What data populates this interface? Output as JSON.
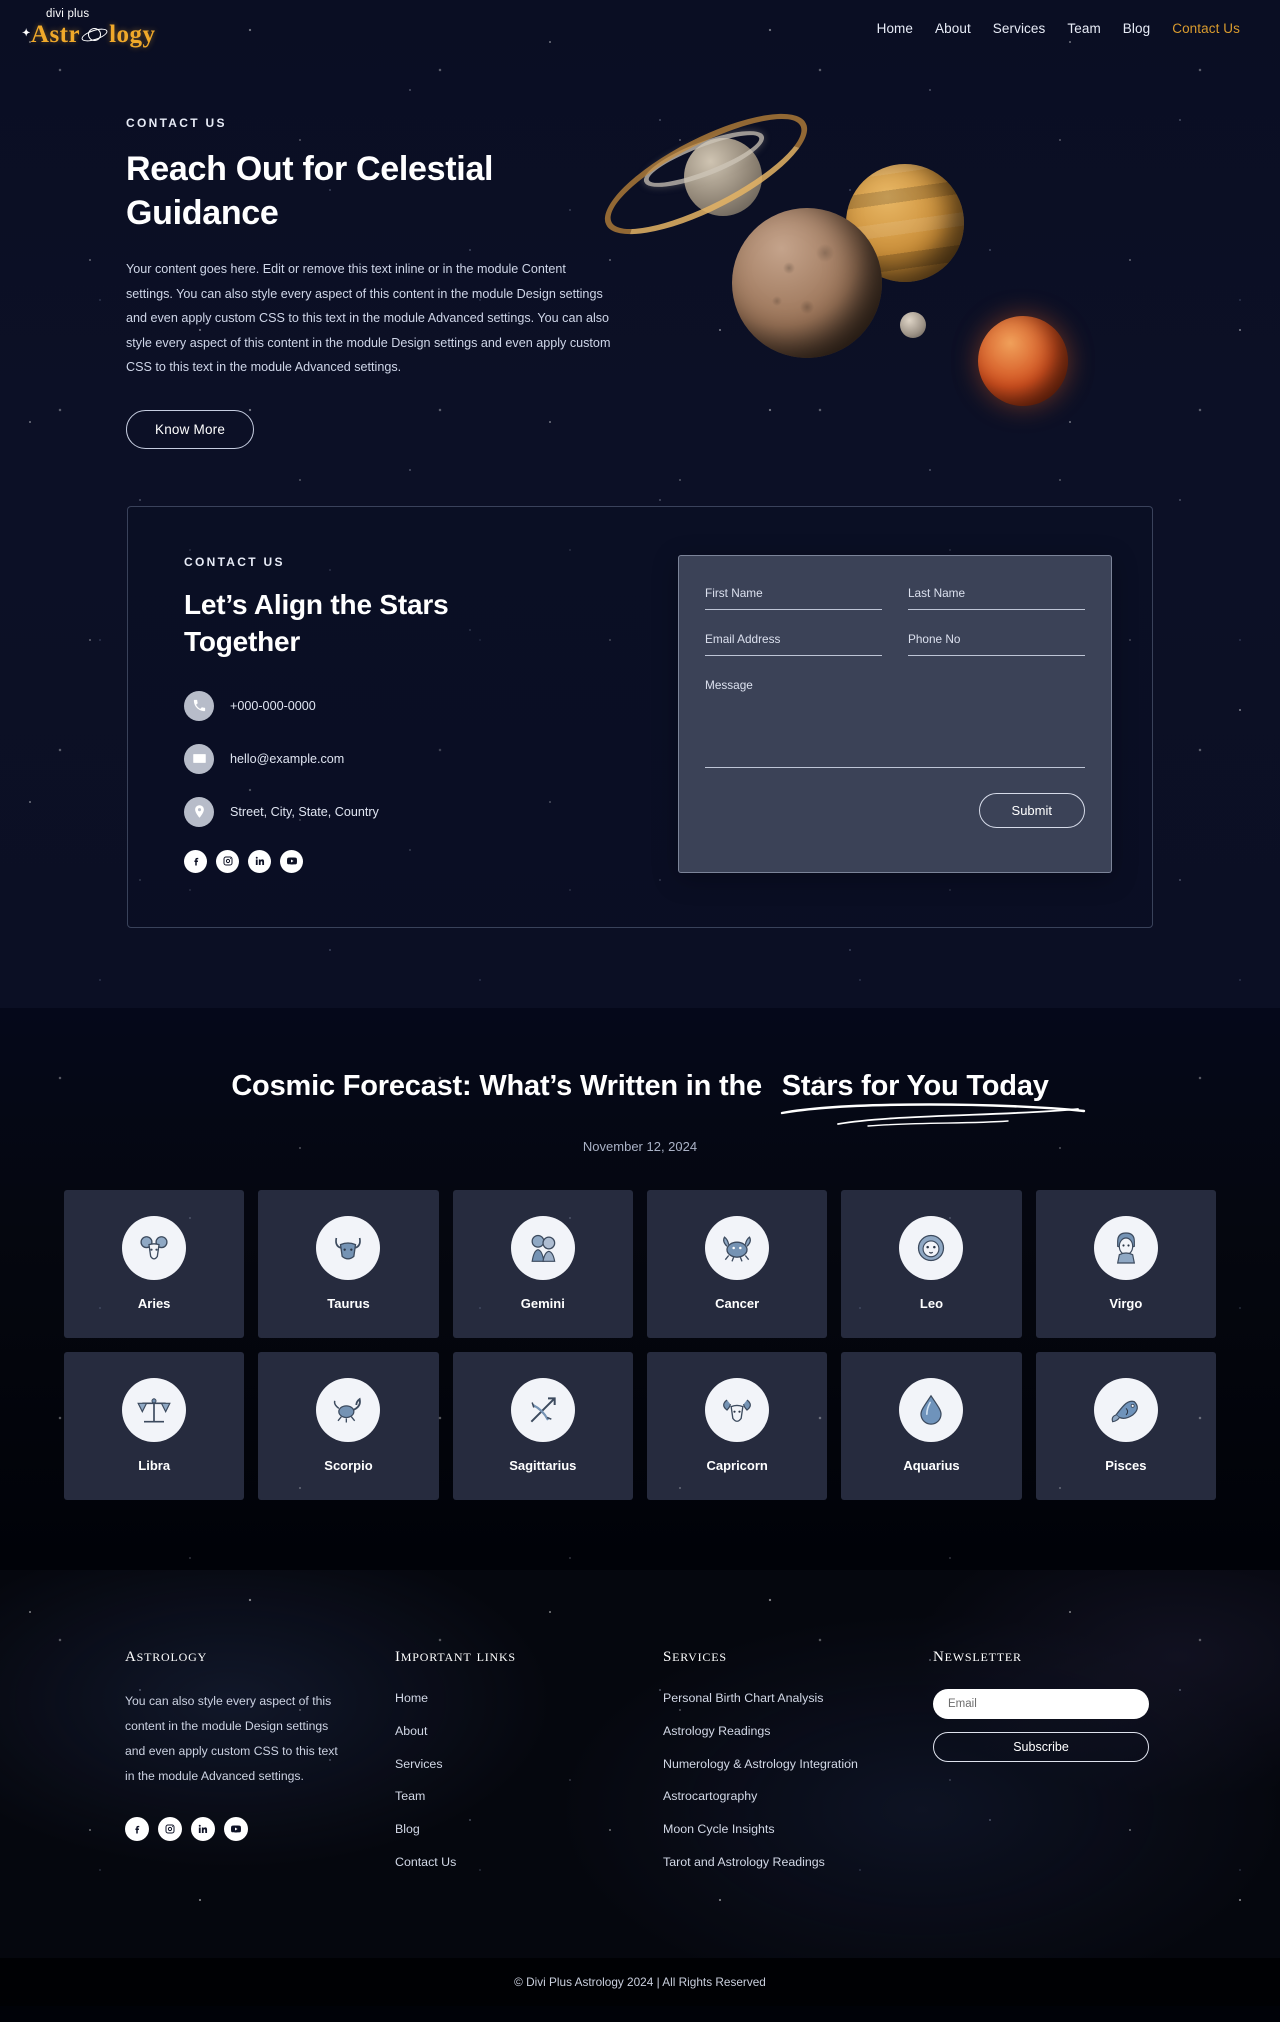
{
  "brand": {
    "logo_top": "divi plus",
    "logo_left": "Astr",
    "logo_right": "logy",
    "accent_color": "#f0a92a"
  },
  "nav": {
    "items": [
      {
        "label": "Home",
        "active": false
      },
      {
        "label": "About",
        "active": false
      },
      {
        "label": "Services",
        "active": false
      },
      {
        "label": "Team",
        "active": false
      },
      {
        "label": "Blog",
        "active": false
      },
      {
        "label": "Contact Us",
        "active": true
      }
    ]
  },
  "hero": {
    "eyebrow": "CONTACT US",
    "title": "Reach Out for Celestial Guidance",
    "body": "Your content goes here. Edit or remove this text inline or in the module Content settings. You can also style every aspect of this content in the module Design settings and even apply custom CSS to this text in the module Advanced settings. You can also style every aspect of this content in the module Design settings and even apply custom CSS to this text in the module Advanced settings.",
    "button": "Know More"
  },
  "contact": {
    "eyebrow": "CONTACT US",
    "title": "Let’s Align the Stars Together",
    "phone": "+000-000-0000",
    "email": "hello@example.com",
    "address": "Street, City, State, Country",
    "socials": [
      "facebook-icon",
      "instagram-icon",
      "linkedin-icon",
      "youtube-icon"
    ],
    "form": {
      "first_name_placeholder": "First Name",
      "last_name_placeholder": "Last Name",
      "email_placeholder": "Email Address",
      "phone_placeholder": "Phone No",
      "message_placeholder": "Message",
      "first_name_value": "",
      "last_name_value": "",
      "email_value": "",
      "phone_value": "",
      "message_value": "",
      "submit_label": "Submit"
    }
  },
  "forecast": {
    "title_plain": "Cosmic Forecast: What’s Written in the",
    "title_highlight": "Stars for You Today",
    "date": "November 12, 2024",
    "signs": [
      {
        "name": "Aries",
        "icon": "ram-icon"
      },
      {
        "name": "Taurus",
        "icon": "bull-icon"
      },
      {
        "name": "Gemini",
        "icon": "twins-icon"
      },
      {
        "name": "Cancer",
        "icon": "crab-icon"
      },
      {
        "name": "Leo",
        "icon": "lion-icon"
      },
      {
        "name": "Virgo",
        "icon": "maiden-icon"
      },
      {
        "name": "Libra",
        "icon": "scales-icon"
      },
      {
        "name": "Scorpio",
        "icon": "scorpion-icon"
      },
      {
        "name": "Sagittarius",
        "icon": "archer-icon"
      },
      {
        "name": "Capricorn",
        "icon": "goat-icon"
      },
      {
        "name": "Aquarius",
        "icon": "waterdrop-icon"
      },
      {
        "name": "Pisces",
        "icon": "fish-icon"
      }
    ]
  },
  "footer": {
    "about": {
      "heading": "Astrology",
      "text": "You can also style every aspect of this content in the module Design settings and even apply custom CSS to this text in the module Advanced settings.",
      "socials": [
        "facebook-icon",
        "instagram-icon",
        "linkedin-icon",
        "youtube-icon"
      ]
    },
    "links": {
      "heading": "Important Links",
      "items": [
        "Home",
        "About",
        "Services",
        "Team",
        "Blog",
        "Contact Us"
      ]
    },
    "services": {
      "heading": "Services",
      "items": [
        "Personal Birth Chart Analysis",
        "Astrology Readings",
        "Numerology & Astrology Integration",
        "Astrocartography",
        "Moon Cycle Insights",
        "Tarot and Astrology Readings"
      ]
    },
    "newsletter": {
      "heading": "Newsletter",
      "placeholder": "Email",
      "value": "",
      "button": "Subscribe"
    },
    "copyright": "© Divi Plus Astrology 2024 | All Rights Reserved"
  }
}
